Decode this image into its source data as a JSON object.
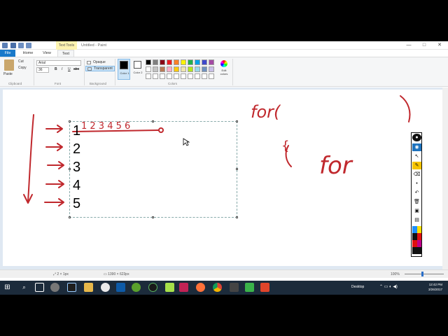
{
  "window": {
    "title": "Untitled - Paint",
    "context_tab": "Text Tools",
    "min_label": "—",
    "max_label": "□",
    "close_label": "✕"
  },
  "tabs": [
    "File",
    "Home",
    "View",
    "Text"
  ],
  "ribbon": {
    "clipboard": {
      "paste": "Paste",
      "cut": "Cut",
      "copy": "Copy",
      "group": "Clipboard"
    },
    "font": {
      "family": "Arial",
      "size": "36",
      "group": "Font",
      "bold": "B",
      "italic": "I",
      "underline": "U",
      "strike": "abc"
    },
    "background": {
      "opaque": "Opaque",
      "transparent": "Transparent",
      "group": "Background"
    },
    "colors": {
      "color1_label": "Color 1",
      "color2_label": "Color 2",
      "edit_label": "Edit colors",
      "group": "Colors",
      "color1": "#000000",
      "color2": "#ffffff",
      "palette_row1": [
        "#000000",
        "#7f7f7f",
        "#880015",
        "#ed1c24",
        "#ff7f27",
        "#fff200",
        "#22b14c",
        "#00a2e8",
        "#3f48cc",
        "#a349a4"
      ],
      "palette_row2": [
        "#ffffff",
        "#c3c3c3",
        "#b97a57",
        "#ffaec9",
        "#ffc90e",
        "#efe4b0",
        "#b5e61d",
        "#99d9ea",
        "#7092be",
        "#c8bfe7"
      ],
      "palette_row3": [
        "#ffffff",
        "#ffffff",
        "#ffffff",
        "#ffffff",
        "#ffffff",
        "#ffffff",
        "#ffffff",
        "#ffffff",
        "#ffffff",
        "#ffffff"
      ]
    }
  },
  "canvas": {
    "typed_numbers": [
      "1",
      "2",
      "3",
      "4",
      "5"
    ],
    "handwriting_top": "1 2 3 4 5 6",
    "handwriting_for1": "for(",
    "handwriting_brace": "{",
    "handwriting_for2": "for",
    "ink_color": "#c0282d"
  },
  "status": {
    "selection_size": "2 × 1px",
    "canvas_size": "1390 × 623px",
    "zoom": "100%"
  },
  "taskbar": {
    "desktop_label": "Desktop",
    "time": "12:42 PM",
    "date": "3/26/2017"
  }
}
